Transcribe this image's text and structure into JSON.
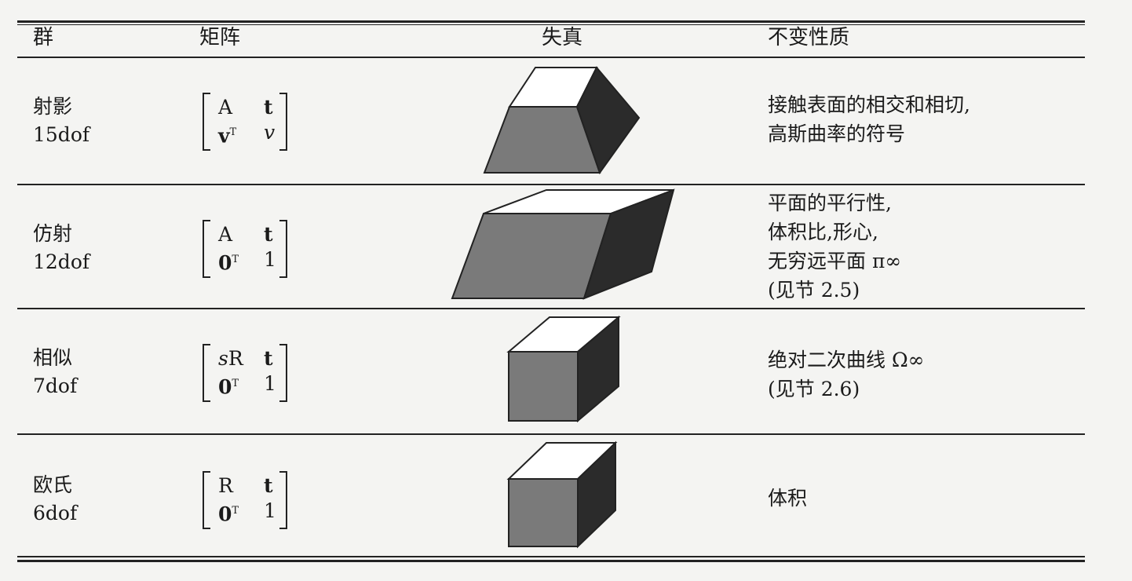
{
  "header": {
    "group": "群",
    "matrix": "矩阵",
    "distortion": "失真",
    "invariants": "不变性质"
  },
  "rows": [
    {
      "group_name": "射影",
      "dof": "15dof",
      "m11": "A",
      "m12": "t",
      "m21": "v",
      "m21_sup": "T",
      "m22": "v",
      "props": [
        "接触表面的相交和相切,",
        "高斯曲率的符号"
      ]
    },
    {
      "group_name": "仿射",
      "dof": "12dof",
      "m11": "A",
      "m12": "t",
      "m21": "0",
      "m21_sup": "T",
      "m22": "1",
      "props": [
        "平面的平行性,",
        "体积比,形心,",
        "无穷远平面 π∞",
        "(见节 2.5)"
      ]
    },
    {
      "group_name": "相似",
      "dof": "7dof",
      "m11_pre": "s",
      "m11": "R",
      "m12": "t",
      "m21": "0",
      "m21_sup": "T",
      "m22": "1",
      "props": [
        "绝对二次曲线 Ω∞",
        "(见节 2.6)"
      ]
    },
    {
      "group_name": "欧氏",
      "dof": "6dof",
      "m11": "R",
      "m12": "t",
      "m21": "0",
      "m21_sup": "T",
      "m22": "1",
      "props": [
        "体积"
      ]
    }
  ],
  "colors": {
    "front_face": "#7a7a7a",
    "side_face": "#2b2b2b",
    "top_face": "#ffffff",
    "rule": "#222222"
  },
  "icons": [
    "projective-box-shape",
    "affine-box-shape",
    "similarity-cube-shape",
    "euclidean-cube-shape"
  ]
}
